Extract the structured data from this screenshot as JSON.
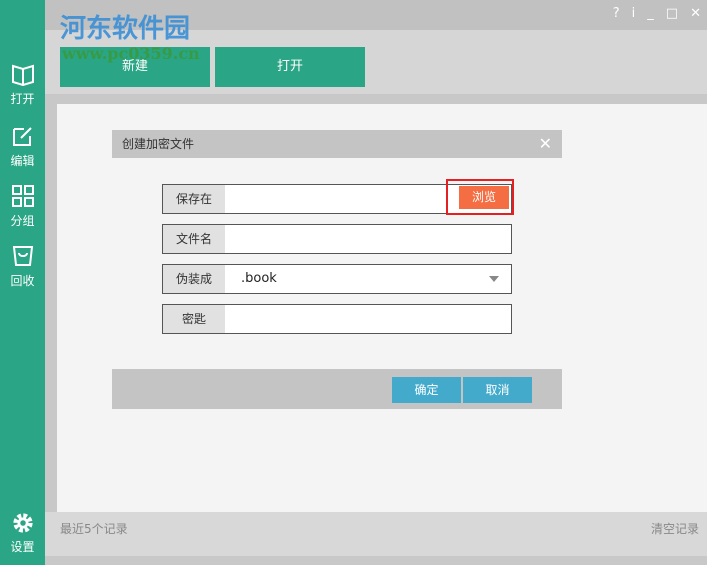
{
  "watermark": {
    "name": "河东软件园",
    "url": "www.pc0359.cn"
  },
  "sidebar": {
    "items": [
      {
        "label": "打开"
      },
      {
        "label": "编辑"
      },
      {
        "label": "分组"
      },
      {
        "label": "回收"
      }
    ],
    "settings": "设置"
  },
  "titlebar": {
    "help": "?",
    "info": "i",
    "minimize": "_",
    "maximize": "□",
    "close": "✕"
  },
  "toolbar": {
    "new": "新建",
    "open": "打开"
  },
  "dialog": {
    "title": "创建加密文件",
    "close": "✕",
    "fields": {
      "save_in": {
        "label": "保存在",
        "value": ""
      },
      "file_name": {
        "label": "文件名",
        "value": ""
      },
      "disguise": {
        "label": "伪装成",
        "value": ".book"
      },
      "key": {
        "label": "密匙",
        "value": ""
      }
    },
    "browse": "浏览",
    "ok": "确定",
    "cancel": "取消"
  },
  "footer": {
    "recent": "最近5个记录",
    "clear": "清空记录"
  }
}
